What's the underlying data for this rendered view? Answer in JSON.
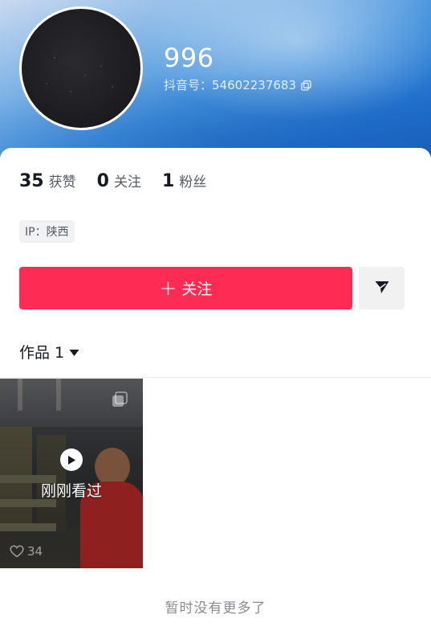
{
  "profile": {
    "nickname": "996",
    "douyin_id_label": "抖音号：",
    "douyin_id": "54602237683"
  },
  "stats": [
    {
      "value": "35",
      "label": "获赞"
    },
    {
      "value": "0",
      "label": "关注"
    },
    {
      "value": "1",
      "label": "粉丝"
    }
  ],
  "ip": {
    "text": "IP：陕西"
  },
  "actions": {
    "follow_label": "关注",
    "share_icon": "send-icon"
  },
  "works": {
    "tab_label": "作品 1",
    "items": [
      {
        "overlay_text": "刚刚看过",
        "likes": "34"
      }
    ]
  },
  "footer": {
    "no_more_text": "暂时没有更多了"
  },
  "colors": {
    "accent": "#fe2c55",
    "header_blue": "#1f6fcb"
  }
}
